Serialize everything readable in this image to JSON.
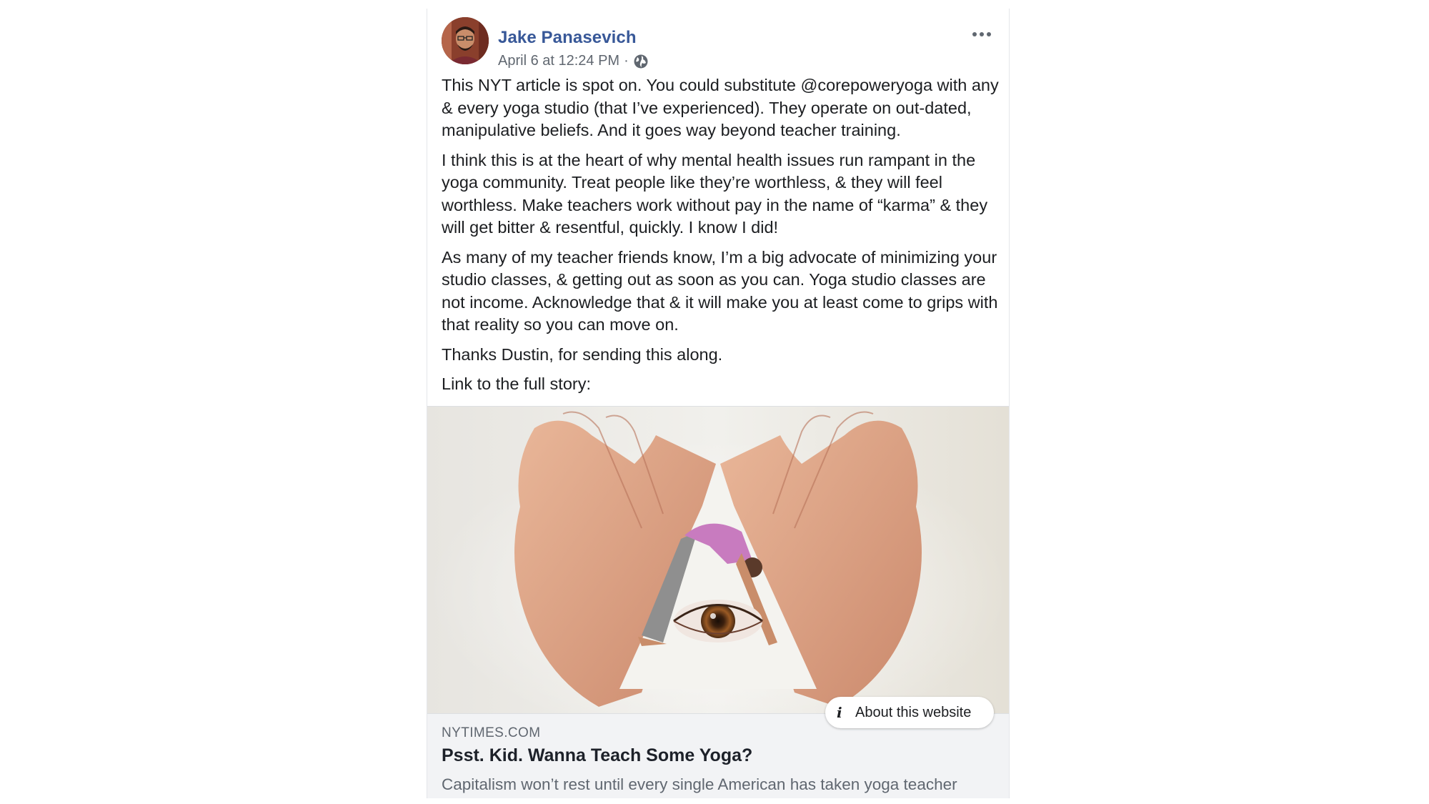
{
  "post": {
    "author": "Jake Panasevich",
    "timestamp": "April 6 at 12:24 PM",
    "separator": "·",
    "privacy_icon": "globe-icon",
    "menu_icon": "more-options-icon",
    "paragraphs": [
      "This NYT article is spot on. You could substitute @corepoweryoga with any & every yoga studio (that I’ve experienced). They operate on out-dated, manipulative beliefs. And it goes way beyond teacher training.",
      "I think this is at the heart of why mental health issues run rampant in the yoga community. Treat people like they’re worthless, & they will feel worthless. Make teachers work without pay in the name of “karma” & they will get bitter & resentful, quickly. I know I did!",
      "As many of my teacher friends know, I’m a big advocate of minimizing your studio classes, & getting out as soon as you can. Yoga studio classes are not income. Acknowledge that & it will make you at least come to grips with that reality so you can move on.",
      "Thanks Dustin, for sending this along.",
      "Link to the full story:"
    ]
  },
  "link_preview": {
    "image_description_icon": "hands-triangle-yoga-eye-image",
    "about_button": "About this website",
    "about_icon": "info-icon",
    "domain": "NYTIMES.COM",
    "headline": "Psst. Kid. Wanna Teach Some Yoga?",
    "description": "Capitalism won’t rest until every single American has taken yoga teacher"
  },
  "colors": {
    "author_link": "#385898",
    "text": "#1c1e21",
    "secondary": "#606770",
    "footer_bg": "#f2f3f5"
  }
}
